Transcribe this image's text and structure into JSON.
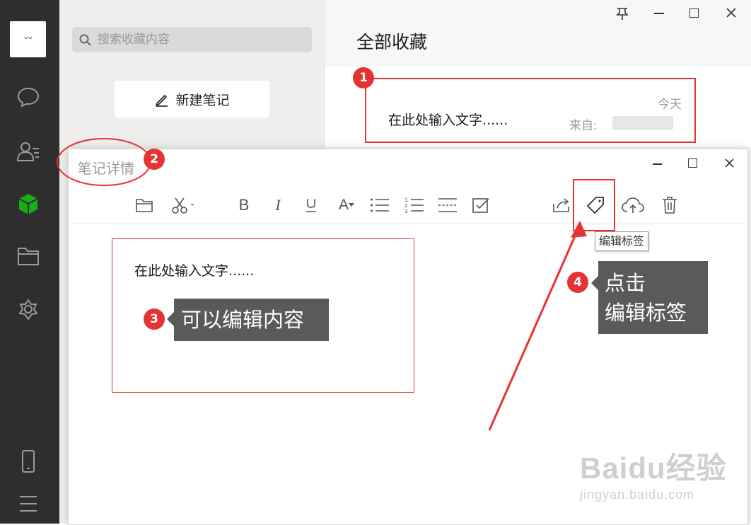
{
  "search": {
    "placeholder": "搜索收藏内容"
  },
  "new_note": {
    "label": "新建笔记"
  },
  "favorites": {
    "title": "全部收藏",
    "item": {
      "text": "在此处输入文字......",
      "date": "今天",
      "source_label": "来自:"
    }
  },
  "note_window": {
    "title": "笔记详情",
    "body_text": "在此处输入文字......",
    "tooltip": "编辑标签"
  },
  "annotations": {
    "badge1": "1",
    "badge2": "2",
    "badge3": "3",
    "badge4": "4",
    "callout3": "可以编辑内容",
    "callout4_line1": "点击",
    "callout4_line2": "编辑标签",
    "color": "#e53333"
  },
  "watermark": {
    "brand": "Baidu经验",
    "url": "jingyan.baidu.com"
  },
  "icons": {
    "sidebar": [
      "chat-icon",
      "contacts-icon",
      "favorites-cube-icon",
      "folder-icon",
      "mini-programs-icon",
      "phone-icon",
      "menu-icon"
    ],
    "toolbar": [
      "open-folder-icon",
      "scissors-icon",
      "bold-icon",
      "italic-icon",
      "underline-icon",
      "font-color-icon",
      "bullet-list-icon",
      "numbered-list-icon",
      "divider-icon",
      "checkbox-icon",
      "share-icon",
      "tag-icon",
      "cloud-upload-icon",
      "trash-icon"
    ]
  }
}
